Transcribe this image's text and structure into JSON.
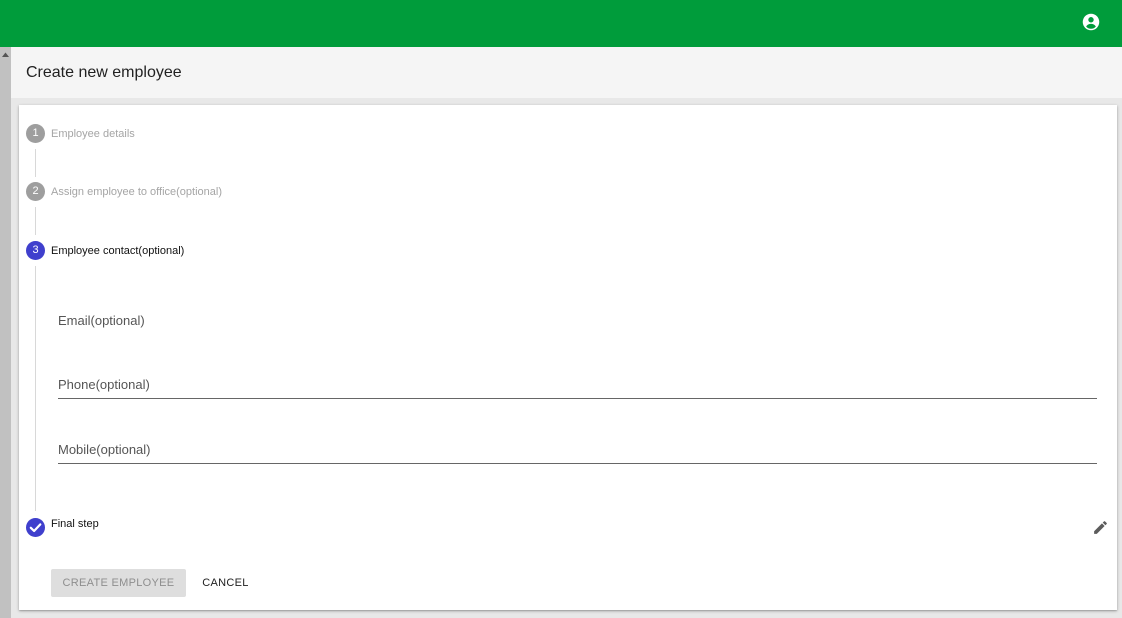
{
  "app": {
    "account_icon": "account-circle-icon",
    "brand_color": "#009c3b"
  },
  "header": {
    "title": "Create new employee"
  },
  "stepper": {
    "steps": [
      {
        "number": "1",
        "label": "Employee details",
        "state": "inactive"
      },
      {
        "number": "2",
        "label": "Assign employee to office(optional)",
        "state": "inactive"
      },
      {
        "number": "3",
        "label": "Employee contact(optional)",
        "state": "active"
      },
      {
        "number": "",
        "label": "Final step",
        "state": "completed",
        "icon": "check-icon"
      }
    ],
    "active_color": "#3f3fcd",
    "inactive_color": "#9e9e9e"
  },
  "form": {
    "email_label": "Email(optional)",
    "phone_label": "Phone(optional)",
    "mobile_label": "Mobile(optional)"
  },
  "actions": {
    "create_label": "CREATE EMPLOYEE",
    "cancel_label": "CANCEL",
    "edit_icon": "pencil-icon"
  }
}
